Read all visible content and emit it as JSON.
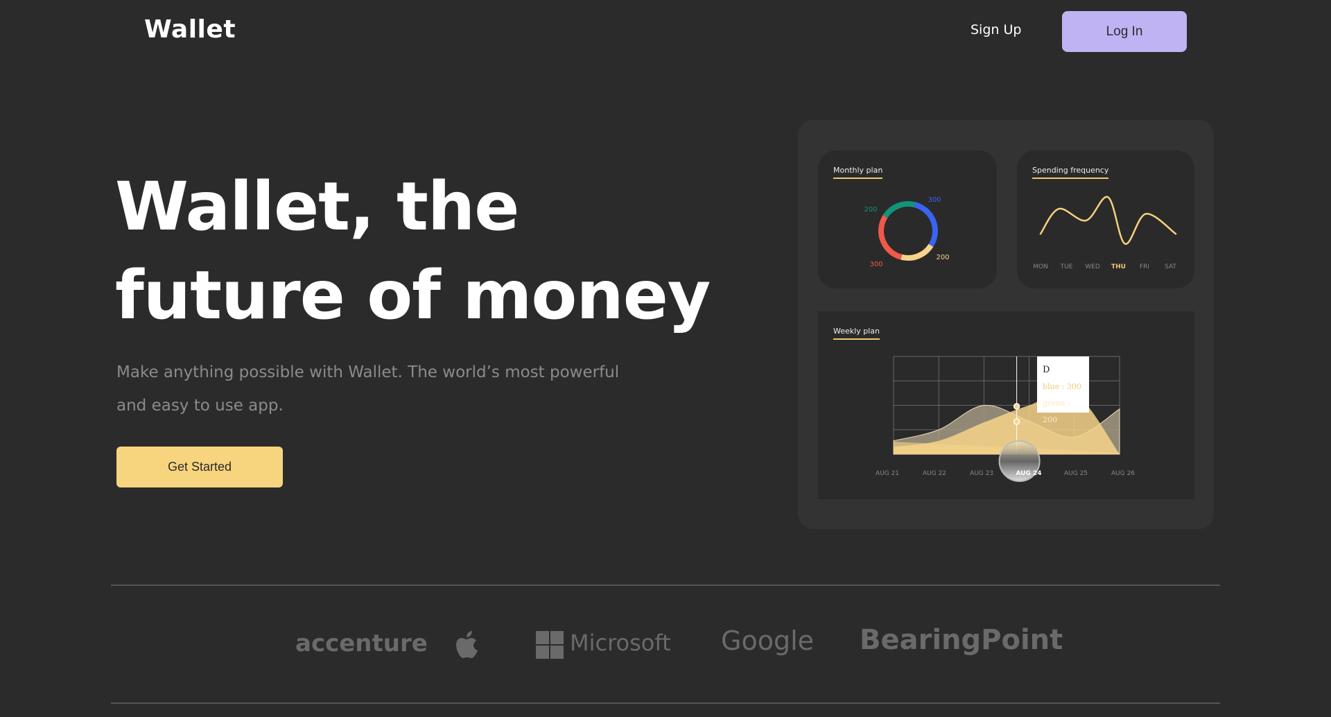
{
  "nav": {
    "logo": "Wallet",
    "signup": "Sign Up",
    "login": "Log In"
  },
  "hero": {
    "title_line1": "Wallet, the",
    "title_line2": "future of money",
    "subtitle_line1": "Make anything possible with Wallet. The world’s most powerful",
    "subtitle_line2": "and easy to use app.",
    "cta": "Get Started"
  },
  "colors": {
    "background": "#2b2b2b",
    "login": "#c0b3f3",
    "cta": "#f7d47e",
    "accent": "#f0c872"
  },
  "dashboard": {
    "monthly_title": "Monthly plan",
    "spending_title": "Spending frequency",
    "weekly_title": "Weekly plan",
    "tooltip": {
      "title": "D",
      "line1": "blue : 300",
      "line2": "green : 200"
    }
  },
  "chart_data": [
    {
      "type": "pie",
      "title": "Monthly plan",
      "donut": true,
      "slices": [
        {
          "label": "300",
          "value": 300,
          "color": "#3a63f2"
        },
        {
          "label": "200",
          "value": 200,
          "color": "#f6d48a"
        },
        {
          "label": "300",
          "value": 300,
          "color": "#f0584a"
        },
        {
          "label": "200",
          "value": 200,
          "color": "#119479"
        }
      ]
    },
    {
      "type": "line",
      "title": "Spending frequency",
      "categories": [
        "MON",
        "TUE",
        "WED",
        "THU",
        "FRI",
        "SAT"
      ],
      "highlight": "THU",
      "points": [
        [
          0,
          14
        ],
        [
          0.7,
          44
        ],
        [
          1.75,
          30
        ],
        [
          2.6,
          58
        ],
        [
          3.25,
          2
        ],
        [
          4.05,
          38
        ],
        [
          5.2,
          14
        ]
      ],
      "color": "#f6d27e"
    },
    {
      "type": "area",
      "title": "Weekly plan",
      "categories": [
        "AUG 21",
        "AUG 22",
        "AUG 23",
        "AUG 24",
        "AUG 25",
        "AUG 26"
      ],
      "highlight": "AUG 24",
      "ylim": [
        0,
        400
      ],
      "grid": true,
      "series": [
        {
          "values": [
            55,
            100,
            200,
            135,
            70,
            185
          ],
          "color": "#a39a84"
        },
        {
          "values": [
            30,
            55,
            130,
            200,
            250,
            0
          ],
          "color": "#f6d48a"
        }
      ]
    }
  ],
  "partners": [
    "accenture",
    "apple",
    "Microsoft",
    "Google",
    "BearingPoint"
  ]
}
